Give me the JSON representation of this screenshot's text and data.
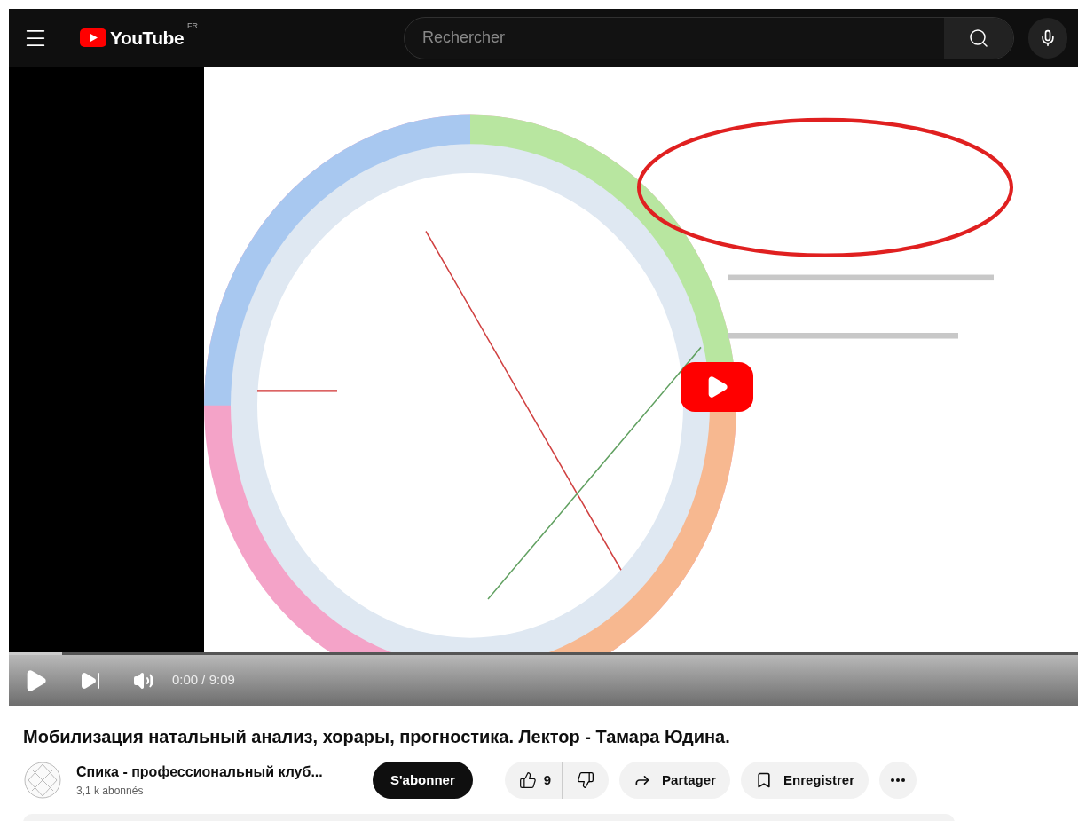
{
  "header": {
    "logo_text": "YouTube",
    "region": "FR",
    "search": {
      "placeholder": "Rechercher"
    }
  },
  "player": {
    "progress": {
      "level": 0.05
    },
    "time": "0:00 / 9:09"
  },
  "video": {
    "title": "Мобилизация натальный анализ, хорары, прогностика. Лектор - Тамара Юдина.",
    "channel": {
      "name": "Спика - профессиональный клуб...",
      "subscribers": "3,1 k abonnés"
    },
    "subscribe": "S'abonner",
    "likes": "9",
    "actions": [
      {
        "kind": "share",
        "label": "Partager"
      },
      {
        "kind": "save",
        "label": "Enregistrer"
      }
    ]
  }
}
